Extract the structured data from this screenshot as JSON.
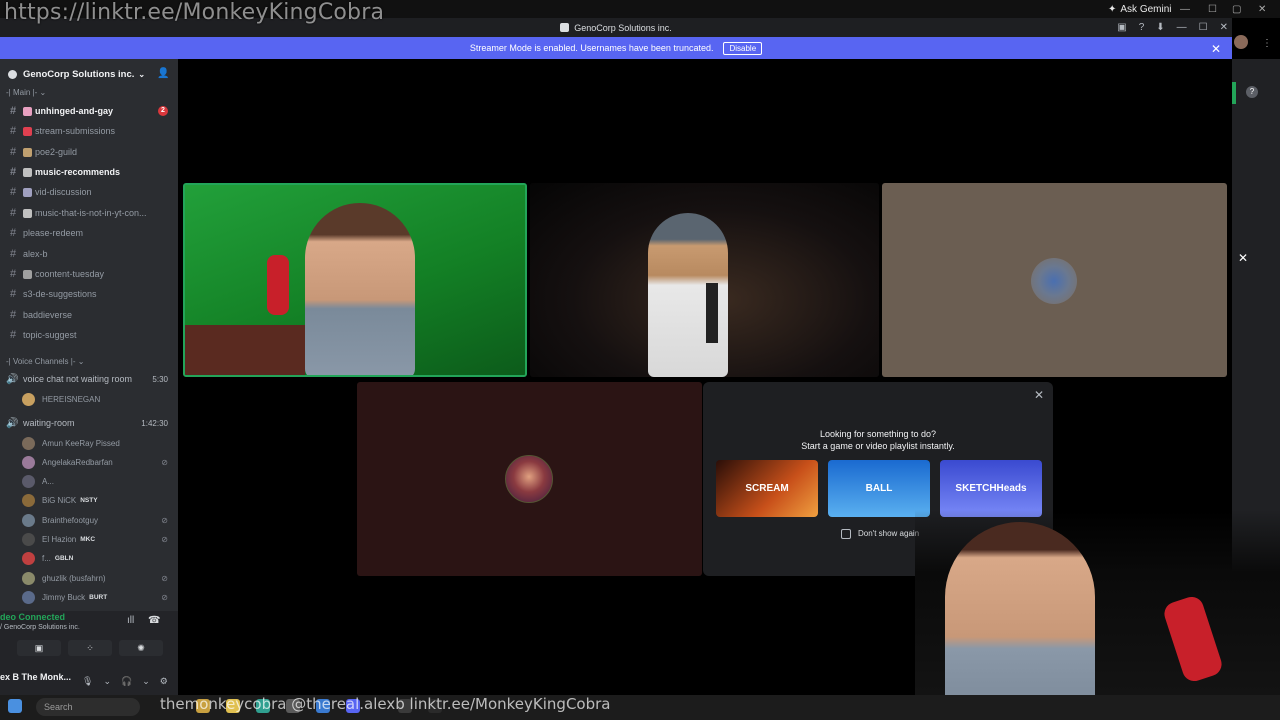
{
  "overlay": {
    "url_text": "https://linktr.ee/MonkeyKingCobra",
    "ticker_text": "themonkeycobra   @thereal.alexb   linktr.ee/MonkeyKingCobra"
  },
  "browser": {
    "ask_gemini": "Ask Gemini"
  },
  "window": {
    "title": "GenoCorp Solutions inc."
  },
  "banner": {
    "text": "Streamer Mode is enabled. Usernames have been truncated.",
    "disable_label": "Disable"
  },
  "server": {
    "name": "GenoCorp Solutions inc."
  },
  "sidebar": {
    "main_category": "-| Main |-",
    "channels": [
      {
        "name": "unhinged-and-gay",
        "bold": true,
        "badge": "2",
        "emoji_color": "#e8a0c0"
      },
      {
        "name": "stream-submissions",
        "bold": false,
        "emoji_color": "#e04050"
      },
      {
        "name": "poe2-guild",
        "bold": false,
        "emoji_color": "#c0a070"
      },
      {
        "name": "music-recommends",
        "bold": true,
        "emoji_color": "#c0c0c0"
      },
      {
        "name": "vid-discussion",
        "bold": false,
        "emoji_color": "#a0a0c0"
      },
      {
        "name": "music-that-is-not-in-yt-con...",
        "bold": false,
        "emoji_color": "#c0c0c0"
      },
      {
        "name": "please-redeem",
        "bold": false
      },
      {
        "name": "alex-b",
        "bold": false
      },
      {
        "name": "coontent-tuesday",
        "bold": false,
        "emoji_color": "#a0a0a0"
      },
      {
        "name": "s3-de-suggestions",
        "bold": false
      },
      {
        "name": "baddieverse",
        "bold": false
      },
      {
        "name": "topic-suggest",
        "bold": false
      }
    ],
    "voice_category": "-| Voice Channels |-",
    "voice_channels": [
      {
        "name": "voice chat not waiting room",
        "timer": "5:30"
      },
      {
        "name": "waiting-room",
        "timer": "1:42:30"
      }
    ],
    "vc1_users": [
      {
        "name": "HEREISNEGAN",
        "tag": ""
      }
    ],
    "vc2_users": [
      {
        "name": "Amun KeeRay Pissed",
        "tag": ""
      },
      {
        "name": "AngelakaRedbarfan",
        "tag": ""
      },
      {
        "name": "A...",
        "tag": ""
      },
      {
        "name": "BiG NiCK",
        "tag": "NSTY"
      },
      {
        "name": "Brainthefootguy",
        "tag": ""
      },
      {
        "name": "El Hazion",
        "tag": "MKC"
      },
      {
        "name": "f...",
        "tag": "GBLN"
      },
      {
        "name": "ghuzlik (busfahrn)",
        "tag": ""
      },
      {
        "name": "Jimmy Buck",
        "tag": "BURT"
      }
    ]
  },
  "voice_panel": {
    "status": "deo Connected",
    "location": "/ GenoCorp Solutions inc."
  },
  "user_panel": {
    "name": "ex B The Monk..."
  },
  "taskbar": {
    "search_placeholder": "Search"
  },
  "activity": {
    "title_line1": "Looking for something to do?",
    "title_line2": "Start a game or video playlist instantly.",
    "cards": [
      "SCREAM",
      "BALL",
      "SKETCHHeads"
    ],
    "dont_show_label": "Don't show again"
  },
  "colors": {
    "discord_blurple": "#5865f2",
    "speaking_green": "#23a559",
    "sidebar_bg": "#2b2d31",
    "mention_red": "#da373c"
  }
}
